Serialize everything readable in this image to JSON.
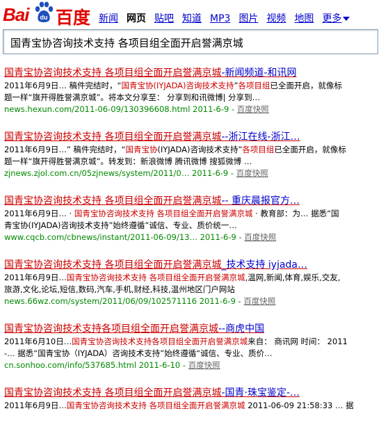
{
  "logo": {
    "latin": "Bai",
    "chinese": "百度",
    "paw_text": "du"
  },
  "nav": {
    "items": [
      "新闻",
      "网页",
      "贴吧",
      "知道",
      "MP3",
      "图片",
      "视频",
      "地图"
    ],
    "active_index": 1,
    "more_label": "更多"
  },
  "search": {
    "query": "国青宝协咨询技术支持 各项目组全面开启誉满京城"
  },
  "results": [
    {
      "title_hl": "国青宝协咨询技术支持 各项目组全面开启誉满京城",
      "title_tail": "-新闻频道-和讯网",
      "line1_pre": "2011年6月9日… 稿件完结时，“",
      "line1_hl": "国青宝协(IYJADA)咨询技术支持",
      "line1_mid": "”",
      "line1_hl2": "各项目组",
      "line1_post": "已全面开启，就像标",
      "line2": "题一样“旗开得胜誉满京城”。将本文分享至： 分享到和讯微博| 分享到…",
      "url": "news.hexun.com/2011-06-09/130396608.html",
      "date": "2011-6-9",
      "cache": "百度快照"
    },
    {
      "title_hl": "国青宝协咨询技术支持 各项目组全面开启誉满京城",
      "title_tail": "--浙江在线-浙江…",
      "line1_pre": "2011年6月9日…” 稿件完结时，“",
      "line1_hl": "国青宝协",
      "line1_mid": "(IYJADA)咨询技术支持”",
      "line1_hl2": "各项目组",
      "line1_post": "已全面开启，就像标",
      "line2": "题一样“旗开得胜誉满京城”。转发到：新浪微博 腾讯微博 搜狐微博 …",
      "url": "zjnews.zjol.com.cn/05zjnews/system/2011/0…",
      "date": "2011-6-9",
      "cache": "百度快照"
    },
    {
      "title_hl": "国青宝协咨询技术支持 各项目组全面开启誉满京城",
      "title_tail": "-- 重庆晨报官方…",
      "line1_pre": "2011年6月9日… · ",
      "line1_hl": "国青宝协咨询技术支持 各项目组全面开启誉满京城",
      "line1_mid": " · 教育部：为… 据悉“国",
      "line1_hl2": "",
      "line1_post": "",
      "line2": "青宝协(IYJADA)咨询技术支持”始终遵循”诚信、专业、质价统一…",
      "url": "www.cqcb.com/cbnews/instant/2011-06-09/13…",
      "date": "2011-6-9",
      "cache": "百度快照"
    },
    {
      "title_hl": "国青宝协咨询技术支持 各项目组全面开启誉满京城",
      "title_tail": "_技术支持 iyjada…",
      "line1_pre": "2011年6月9日…",
      "line1_hl": "国青宝协咨询技术支持 各项目组全面开启誉满京城",
      "line1_mid": ",温网,新闻,体育,娱乐,交友,",
      "line1_hl2": "",
      "line1_post": "",
      "line2": "旅游,文化,论坛,短信,数码,汽车,手机,财经,科技,温州地区门户网站",
      "url": "news.66wz.com/system/2011/06/09/102571116",
      "date": "2011-6-9",
      "cache": "百度快照"
    },
    {
      "title_hl": "国青宝协咨询技术支持各项目组全面开启誉满京城",
      "title_tail": "--商虎中国",
      "line1_pre": "2011年6月10日…",
      "line1_hl": "国青宝协咨询技术支持各项目组全面开启誉满京城",
      "line1_mid": "来自： 商讯网 时间： 2011",
      "line1_hl2": "",
      "line1_post": "",
      "line2": "-… 据悉“国青宝协（IYJADA）咨询技术支持”始终遵循“诚信、专业、质价…",
      "url": "cn.sonhoo.com/info/537685.html",
      "date": "2011-6-10",
      "cache": "百度快照"
    },
    {
      "title_hl": "国青宝协咨询技术支持 各项目组全面开启誉满京城",
      "title_tail": "-国青·珠宝鉴定-…",
      "line1_pre": "2011年6月9日…",
      "line1_hl": "国青宝协咨询技术支持 各项目组全面开启誉满京城",
      "line1_mid": " 2011-06-09 21:58:33 … 据",
      "line1_hl2": "",
      "line1_post": "",
      "line2": "",
      "url": "",
      "date": "",
      "cache": ""
    }
  ]
}
